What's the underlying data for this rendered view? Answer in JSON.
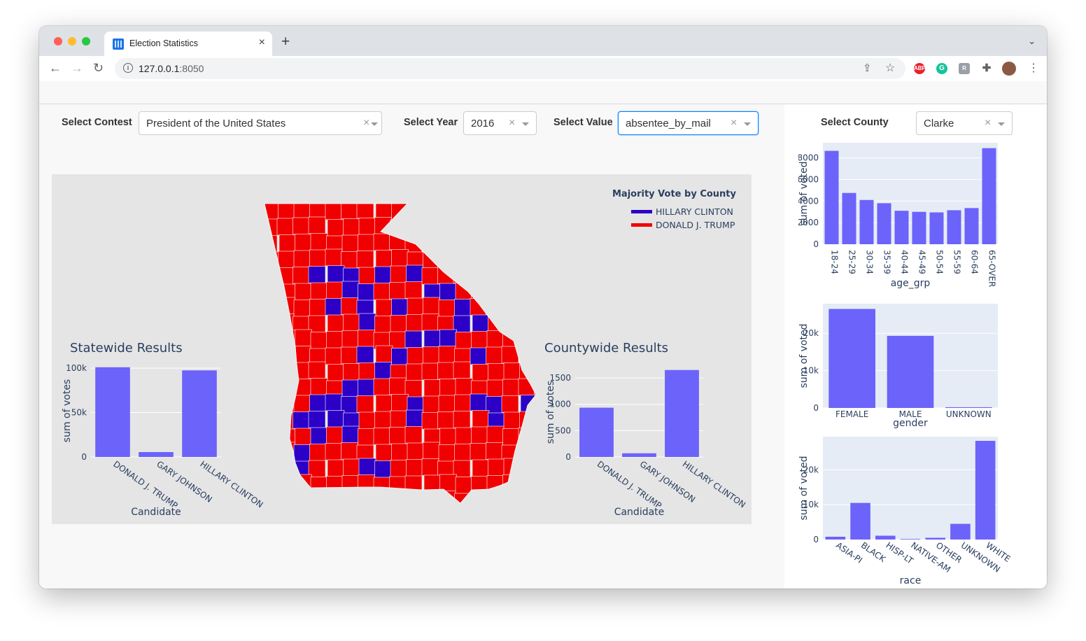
{
  "browser": {
    "tab_title": "Election Statistics",
    "url_host": "127.0.0.1",
    "url_port": ":8050"
  },
  "controls": {
    "contest_label": "Select Contest",
    "contest_value": "President of the United States",
    "year_label": "Select Year",
    "year_value": "2016",
    "value_label": "Select Value",
    "value_value": "absentee_by_mail",
    "county_label": "Select County",
    "county_value": "Clarke"
  },
  "map": {
    "legend_title": "Majority Vote by County",
    "legend": [
      {
        "name": "HILLARY CLINTON",
        "color": "#2c00c6"
      },
      {
        "name": "DONALD J. TRUMP",
        "color": "#f00000"
      }
    ]
  },
  "chart_data": [
    {
      "id": "statewide",
      "type": "bar",
      "title": "Statewide Results",
      "xlabel": "Candidate",
      "ylabel": "sum of votes",
      "categories": [
        "DONALD J. TRUMP",
        "GARY JOHNSON",
        "HILLARY CLINTON"
      ],
      "values": [
        101000,
        5500,
        97500
      ],
      "ylim": [
        0,
        104000
      ],
      "yticks": [
        {
          "v": 0,
          "t": "0"
        },
        {
          "v": 50000,
          "t": "50k"
        },
        {
          "v": 100000,
          "t": "100k"
        }
      ],
      "bar_color": "#6c63fa"
    },
    {
      "id": "countywide",
      "type": "bar",
      "title": "Countywide Results",
      "xlabel": "Candidate",
      "ylabel": "sum of votes",
      "categories": [
        "DONALD J. TRUMP",
        "GARY JOHNSON",
        "HILLARY CLINTON"
      ],
      "values": [
        935,
        70,
        1650
      ],
      "ylim": [
        0,
        1700
      ],
      "yticks": [
        {
          "v": 0,
          "t": "0"
        },
        {
          "v": 500,
          "t": "500"
        },
        {
          "v": 1000,
          "t": "1000"
        },
        {
          "v": 1500,
          "t": "1500"
        }
      ],
      "bar_color": "#6c63fa"
    },
    {
      "id": "age",
      "type": "bar",
      "xlabel": "age_grp",
      "ylabel": "sum of voted",
      "categories": [
        "18-24",
        "25-29",
        "30-34",
        "35-39",
        "40-44",
        "45-49",
        "50-54",
        "55-59",
        "60-64",
        "65-OVER"
      ],
      "values": [
        8650,
        4750,
        4100,
        3800,
        3100,
        3000,
        2950,
        3150,
        3350,
        8900
      ],
      "ylim": [
        0,
        9400
      ],
      "yticks": [
        {
          "v": 0,
          "t": "0"
        },
        {
          "v": 2000,
          "t": "2000"
        },
        {
          "v": 4000,
          "t": "4000"
        },
        {
          "v": 6000,
          "t": "6000"
        },
        {
          "v": 8000,
          "t": "8000"
        }
      ],
      "bar_color": "#6c63fa"
    },
    {
      "id": "gender",
      "type": "bar",
      "xlabel": "gender",
      "ylabel": "sum of voted",
      "categories": [
        "FEMALE",
        "MALE",
        "UNKNOWN"
      ],
      "values": [
        26500,
        19300,
        200
      ],
      "ylim": [
        0,
        27900
      ],
      "yticks": [
        {
          "v": 0,
          "t": "0"
        },
        {
          "v": 10000,
          "t": "10k"
        },
        {
          "v": 20000,
          "t": "20k"
        }
      ],
      "bar_color": "#6c63fa"
    },
    {
      "id": "race",
      "type": "bar",
      "xlabel": "race",
      "ylabel": "sum of voted",
      "categories": [
        "ASIA-PI",
        "BLACK",
        "HISP-LT",
        "NATIVE-AM",
        "OTHER",
        "UNKNOWN",
        "WHITE"
      ],
      "values": [
        800,
        10500,
        1100,
        150,
        500,
        4500,
        28300
      ],
      "ylim": [
        0,
        29500
      ],
      "yticks": [
        {
          "v": 0,
          "t": "0"
        },
        {
          "v": 10000,
          "t": "10k"
        },
        {
          "v": 20000,
          "t": "20k"
        }
      ],
      "bar_color": "#6c63fa"
    }
  ]
}
